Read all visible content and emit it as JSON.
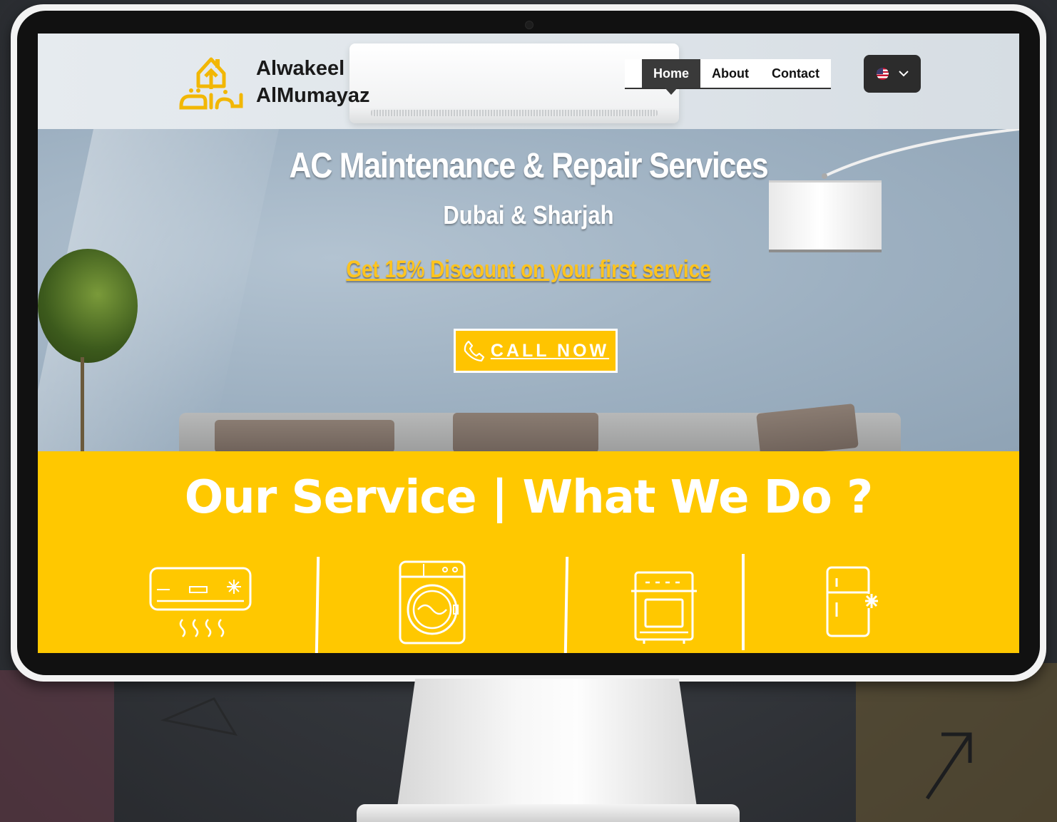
{
  "brand": {
    "line1": "Alwakeel",
    "line2": "AlMumayaz"
  },
  "nav": {
    "items": [
      {
        "label": "Home",
        "active": true
      },
      {
        "label": "About",
        "active": false
      },
      {
        "label": "Contact",
        "active": false
      }
    ]
  },
  "language": {
    "icon": "us-flag-icon"
  },
  "hero": {
    "title": "AC Maintenance & Repair Services",
    "subtitle": "Dubai & Sharjah",
    "discount": "Get 15% Discount on your first service",
    "cta_label": "CALL NOW"
  },
  "services": {
    "title": "Our Service | What We Do ?",
    "icons": [
      "air-conditioner-icon",
      "washing-machine-icon",
      "oven-icon",
      "refrigerator-icon"
    ]
  },
  "colors": {
    "accent": "#ffc800",
    "nav_active": "#3a3a3a",
    "hero_bg": "#9fb1c1"
  }
}
